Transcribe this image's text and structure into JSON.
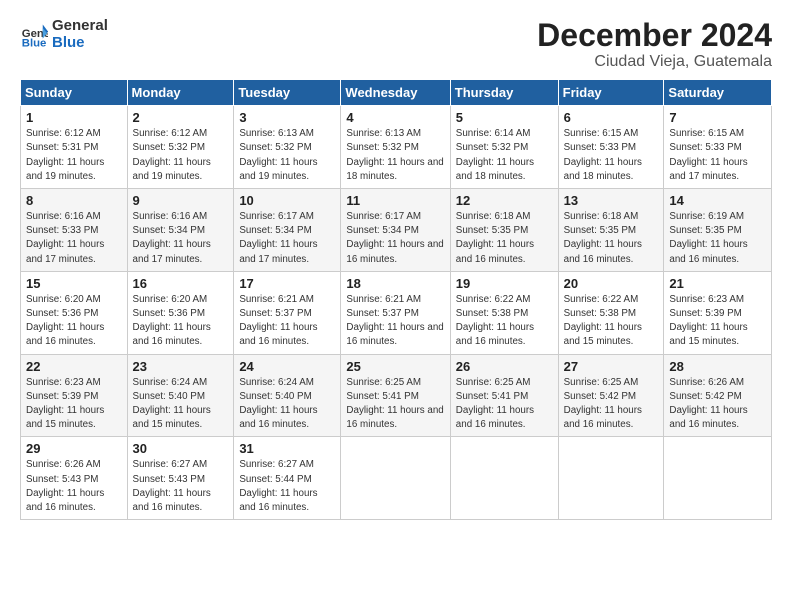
{
  "header": {
    "logo_general": "General",
    "logo_blue": "Blue",
    "month": "December 2024",
    "location": "Ciudad Vieja, Guatemala"
  },
  "weekdays": [
    "Sunday",
    "Monday",
    "Tuesday",
    "Wednesday",
    "Thursday",
    "Friday",
    "Saturday"
  ],
  "days": [
    {
      "num": "1",
      "sunrise": "6:12 AM",
      "sunset": "5:31 PM",
      "daylight": "11 hours and 19 minutes."
    },
    {
      "num": "2",
      "sunrise": "6:12 AM",
      "sunset": "5:32 PM",
      "daylight": "11 hours and 19 minutes."
    },
    {
      "num": "3",
      "sunrise": "6:13 AM",
      "sunset": "5:32 PM",
      "daylight": "11 hours and 19 minutes."
    },
    {
      "num": "4",
      "sunrise": "6:13 AM",
      "sunset": "5:32 PM",
      "daylight": "11 hours and 18 minutes."
    },
    {
      "num": "5",
      "sunrise": "6:14 AM",
      "sunset": "5:32 PM",
      "daylight": "11 hours and 18 minutes."
    },
    {
      "num": "6",
      "sunrise": "6:15 AM",
      "sunset": "5:33 PM",
      "daylight": "11 hours and 18 minutes."
    },
    {
      "num": "7",
      "sunrise": "6:15 AM",
      "sunset": "5:33 PM",
      "daylight": "11 hours and 17 minutes."
    },
    {
      "num": "8",
      "sunrise": "6:16 AM",
      "sunset": "5:33 PM",
      "daylight": "11 hours and 17 minutes."
    },
    {
      "num": "9",
      "sunrise": "6:16 AM",
      "sunset": "5:34 PM",
      "daylight": "11 hours and 17 minutes."
    },
    {
      "num": "10",
      "sunrise": "6:17 AM",
      "sunset": "5:34 PM",
      "daylight": "11 hours and 17 minutes."
    },
    {
      "num": "11",
      "sunrise": "6:17 AM",
      "sunset": "5:34 PM",
      "daylight": "11 hours and 16 minutes."
    },
    {
      "num": "12",
      "sunrise": "6:18 AM",
      "sunset": "5:35 PM",
      "daylight": "11 hours and 16 minutes."
    },
    {
      "num": "13",
      "sunrise": "6:18 AM",
      "sunset": "5:35 PM",
      "daylight": "11 hours and 16 minutes."
    },
    {
      "num": "14",
      "sunrise": "6:19 AM",
      "sunset": "5:35 PM",
      "daylight": "11 hours and 16 minutes."
    },
    {
      "num": "15",
      "sunrise": "6:20 AM",
      "sunset": "5:36 PM",
      "daylight": "11 hours and 16 minutes."
    },
    {
      "num": "16",
      "sunrise": "6:20 AM",
      "sunset": "5:36 PM",
      "daylight": "11 hours and 16 minutes."
    },
    {
      "num": "17",
      "sunrise": "6:21 AM",
      "sunset": "5:37 PM",
      "daylight": "11 hours and 16 minutes."
    },
    {
      "num": "18",
      "sunrise": "6:21 AM",
      "sunset": "5:37 PM",
      "daylight": "11 hours and 16 minutes."
    },
    {
      "num": "19",
      "sunrise": "6:22 AM",
      "sunset": "5:38 PM",
      "daylight": "11 hours and 16 minutes."
    },
    {
      "num": "20",
      "sunrise": "6:22 AM",
      "sunset": "5:38 PM",
      "daylight": "11 hours and 15 minutes."
    },
    {
      "num": "21",
      "sunrise": "6:23 AM",
      "sunset": "5:39 PM",
      "daylight": "11 hours and 15 minutes."
    },
    {
      "num": "22",
      "sunrise": "6:23 AM",
      "sunset": "5:39 PM",
      "daylight": "11 hours and 15 minutes."
    },
    {
      "num": "23",
      "sunrise": "6:24 AM",
      "sunset": "5:40 PM",
      "daylight": "11 hours and 15 minutes."
    },
    {
      "num": "24",
      "sunrise": "6:24 AM",
      "sunset": "5:40 PM",
      "daylight": "11 hours and 16 minutes."
    },
    {
      "num": "25",
      "sunrise": "6:25 AM",
      "sunset": "5:41 PM",
      "daylight": "11 hours and 16 minutes."
    },
    {
      "num": "26",
      "sunrise": "6:25 AM",
      "sunset": "5:41 PM",
      "daylight": "11 hours and 16 minutes."
    },
    {
      "num": "27",
      "sunrise": "6:25 AM",
      "sunset": "5:42 PM",
      "daylight": "11 hours and 16 minutes."
    },
    {
      "num": "28",
      "sunrise": "6:26 AM",
      "sunset": "5:42 PM",
      "daylight": "11 hours and 16 minutes."
    },
    {
      "num": "29",
      "sunrise": "6:26 AM",
      "sunset": "5:43 PM",
      "daylight": "11 hours and 16 minutes."
    },
    {
      "num": "30",
      "sunrise": "6:27 AM",
      "sunset": "5:43 PM",
      "daylight": "11 hours and 16 minutes."
    },
    {
      "num": "31",
      "sunrise": "6:27 AM",
      "sunset": "5:44 PM",
      "daylight": "11 hours and 16 minutes."
    }
  ],
  "start_day": 0,
  "labels": {
    "sunrise": "Sunrise: ",
    "sunset": "Sunset: ",
    "daylight": "Daylight: "
  }
}
